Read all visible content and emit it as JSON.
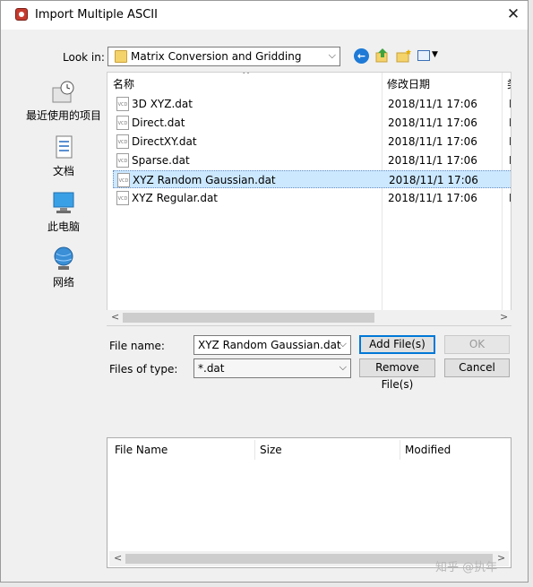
{
  "window": {
    "title": "Import Multiple ASCII",
    "close_glyph": "✕"
  },
  "look_in": {
    "label": "Look in:",
    "value": "Matrix Conversion and Gridding"
  },
  "places": [
    {
      "label": "最近使用的项目",
      "icon": "recent-icon"
    },
    {
      "label": "文档",
      "icon": "documents-icon"
    },
    {
      "label": "此电脑",
      "icon": "this-pc-icon"
    },
    {
      "label": "网络",
      "icon": "network-icon"
    }
  ],
  "file_list": {
    "columns": [
      "名称",
      "修改日期",
      "类"
    ],
    "rows": [
      {
        "name": "3D XYZ.dat",
        "modified": "2018/11/1 17:06",
        "extra": "D"
      },
      {
        "name": "Direct.dat",
        "modified": "2018/11/1 17:06",
        "extra": "D"
      },
      {
        "name": "DirectXY.dat",
        "modified": "2018/11/1 17:06",
        "extra": "D"
      },
      {
        "name": "Sparse.dat",
        "modified": "2018/11/1 17:06",
        "extra": "D"
      },
      {
        "name": "XYZ Random Gaussian.dat",
        "modified": "2018/11/1 17:06",
        "extra": "D",
        "selected": true
      },
      {
        "name": "XYZ Regular.dat",
        "modified": "2018/11/1 17:06",
        "extra": "D"
      }
    ]
  },
  "file_name": {
    "label": "File name:",
    "value": "XYZ Random Gaussian.dat"
  },
  "file_type": {
    "label": "Files of type:",
    "value": "*.dat"
  },
  "buttons": {
    "add": "Add File(s)",
    "ok": "OK",
    "remove": "Remove File(s)",
    "cancel": "Cancel"
  },
  "selected_list": {
    "columns": [
      "File Name",
      "Size",
      "Modified"
    ]
  },
  "watermark": "知乎 @执年"
}
